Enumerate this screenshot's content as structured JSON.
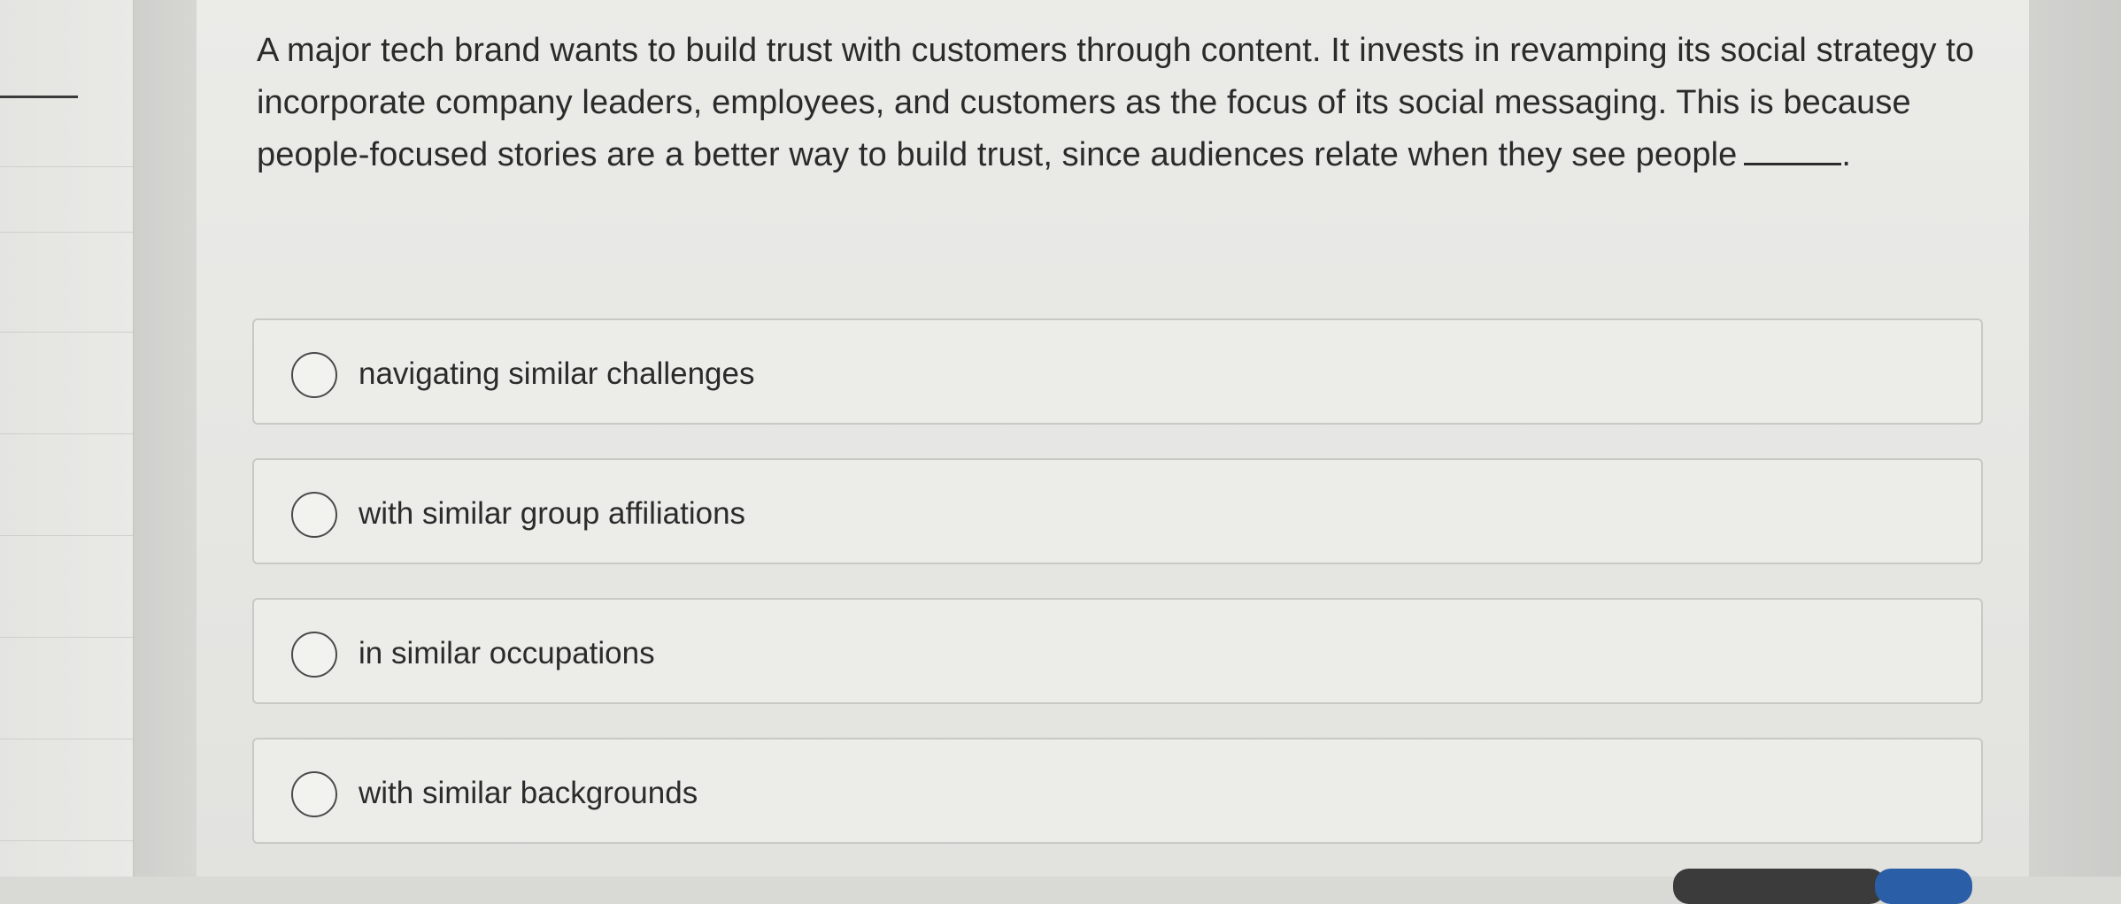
{
  "question": {
    "text": "A major tech brand wants to build trust with customers through content. It invests in revamping its social strategy to incorporate company leaders, employees, and customers as the focus of its social messaging. This is because people-focused stories are a better way to build trust, since audiences relate when they see people",
    "end_punctuation": "."
  },
  "options": [
    {
      "label": "navigating similar challenges",
      "selected": false
    },
    {
      "label": "with similar group affiliations",
      "selected": false
    },
    {
      "label": "in similar occupations",
      "selected": false
    },
    {
      "label": "with similar backgrounds",
      "selected": false
    }
  ],
  "colors": {
    "text": "#2b2b2b",
    "option_border": "#c8c8c4",
    "radio_border": "#4a4a4a",
    "panel_bg": "#e8e8e5"
  }
}
